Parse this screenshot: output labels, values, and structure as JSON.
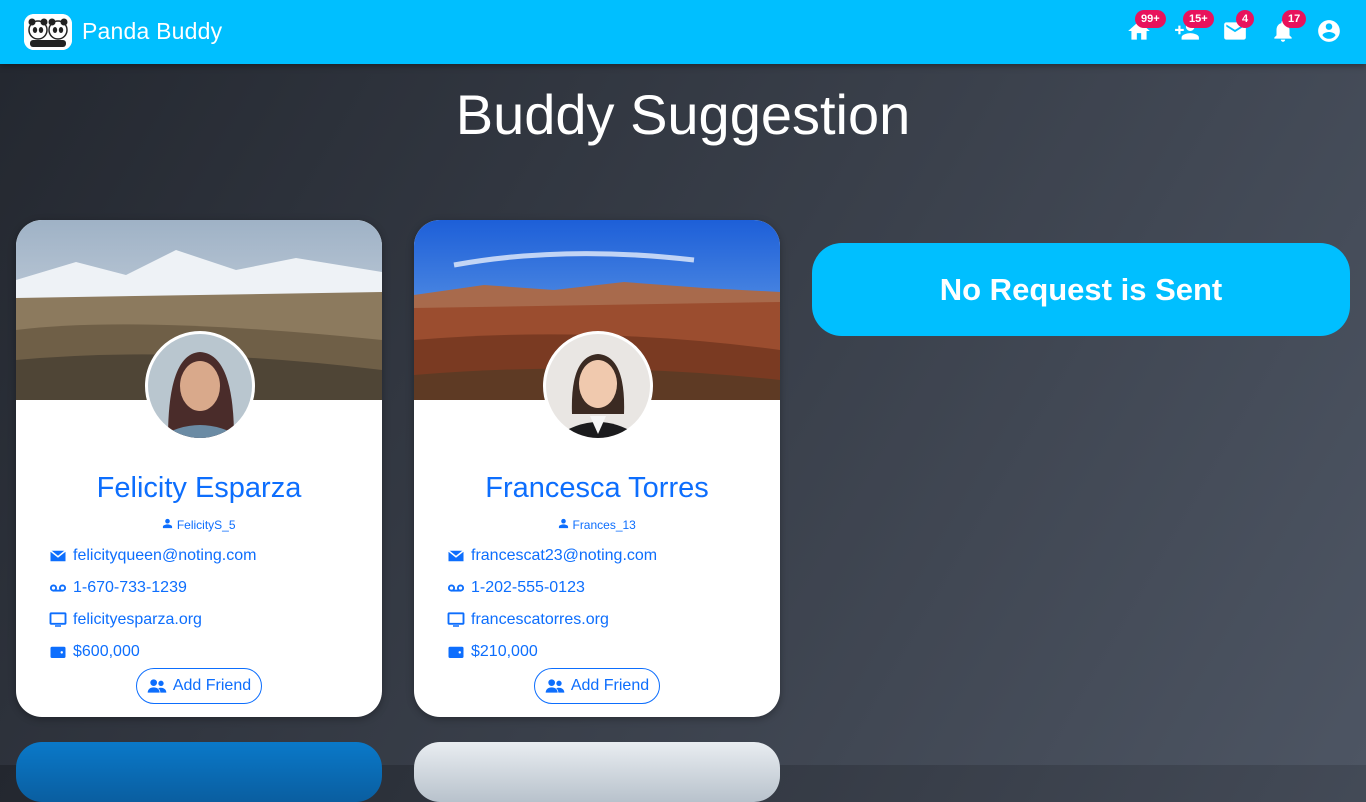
{
  "app": {
    "name": "Panda Buddy"
  },
  "navbar": {
    "icons": [
      {
        "name": "home-icon",
        "badge": "99+"
      },
      {
        "name": "friend-request-icon",
        "badge": "15+"
      },
      {
        "name": "mail-icon",
        "badge": "4"
      },
      {
        "name": "bell-icon",
        "badge": "17"
      },
      {
        "name": "account-icon",
        "badge": ""
      }
    ]
  },
  "page": {
    "title": "Buddy Suggestion"
  },
  "suggestions": [
    {
      "name": "Felicity Esparza",
      "username": "FelicityS_5",
      "email": "felicityqueen@noting.com",
      "phone": "1-670-733-1239",
      "website": "felicityesparza.org",
      "amount": "$600,000",
      "button": "Add Friend"
    },
    {
      "name": "Francesca Torres",
      "username": "Frances_13",
      "email": "francescat23@noting.com",
      "phone": "1-202-555-0123",
      "website": "francescatorres.org",
      "amount": "$210,000",
      "button": "Add Friend"
    }
  ],
  "requests": {
    "empty_message": "No Request is Sent"
  },
  "colors": {
    "accent": "#00bfff",
    "link": "#0d6efd",
    "badge": "#e8125c"
  }
}
